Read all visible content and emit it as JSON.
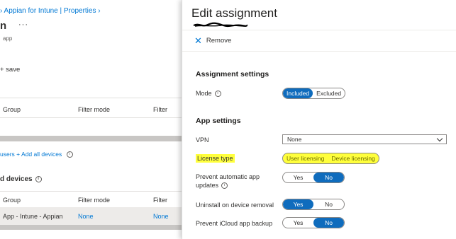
{
  "left": {
    "breadcrumb": "› Appian for Intune | Properties ›",
    "title": "n",
    "more": "···",
    "subtitle": "app",
    "save": "+ save",
    "table1": {
      "headers": [
        "Group",
        "Filter mode",
        "Filter"
      ]
    },
    "links": {
      "users": "users",
      "add_all_devices": "+ Add all devices"
    },
    "section_title": "d devices",
    "table2": {
      "headers": [
        "Group",
        "Filter mode",
        "Filter"
      ],
      "row": [
        "App - Intune - Appian",
        "None",
        "None"
      ]
    }
  },
  "panel": {
    "title": "Edit assignment",
    "remove": "Remove",
    "assignment_settings": "Assignment settings",
    "mode": {
      "label": "Mode",
      "options": [
        "Included",
        "Excluded"
      ],
      "selected": "Included"
    },
    "app_settings": "App settings",
    "vpn": {
      "label": "VPN",
      "value": "None"
    },
    "license_type": {
      "label": "License type",
      "options": [
        "User licensing",
        "Device licensing"
      ],
      "highlight_color": "#ffff3c"
    },
    "prevent_auto_updates": {
      "label_line1": "Prevent automatic app",
      "label_line2": "updates",
      "options": [
        "Yes",
        "No"
      ],
      "selected": "No"
    },
    "uninstall_on_removal": {
      "label": "Uninstall on device removal",
      "options": [
        "Yes",
        "No"
      ],
      "selected": "Yes"
    },
    "prevent_icloud_backup": {
      "label": "Prevent iCloud app backup",
      "options": [
        "Yes",
        "No"
      ],
      "selected": "No"
    }
  },
  "colors": {
    "accent": "#0f6cbd",
    "link": "#0078d4",
    "highlight": "#ffff3c"
  }
}
